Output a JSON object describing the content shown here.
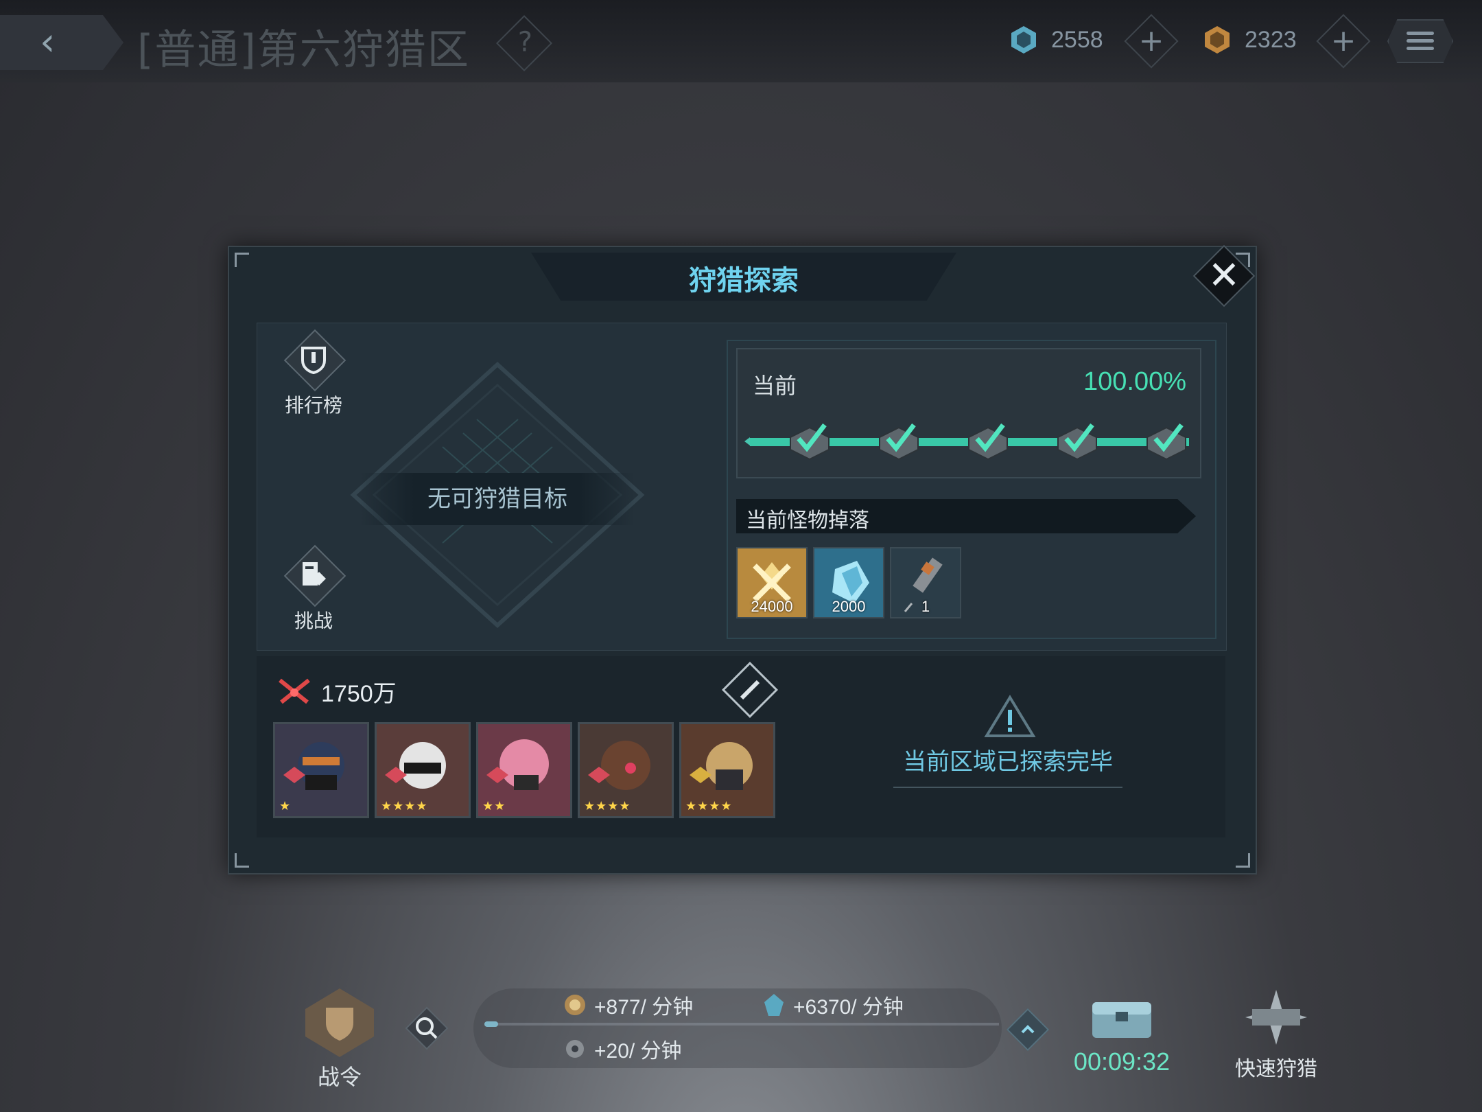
{
  "header": {
    "back_icon": "back-arrow-icon",
    "zone_title": "[普通]第六狩猎区",
    "help_label": "?",
    "resource1": {
      "icon": "blue-crystal-icon",
      "value": "2558"
    },
    "resource2": {
      "icon": "gold-crystal-icon",
      "value": "2323"
    },
    "plus_label": "+",
    "menu_icon": "menu-icon"
  },
  "panel": {
    "title": "狩猎探索",
    "close_label": "✕",
    "ranking_label": "排行榜",
    "challenge_label": "挑战",
    "target_label": "无可狩猎目标",
    "progress": {
      "label": "当前",
      "percent_text": "100.00%",
      "percent": 100,
      "checkpoints": [
        true,
        true,
        true,
        true,
        true
      ]
    },
    "drops_title": "当前怪物掉落",
    "drops": [
      {
        "icon": "gold-medal-icon",
        "count": "24000",
        "color": "#b88a3e"
      },
      {
        "icon": "blue-crystal-icon",
        "count": "2000",
        "color": "#2e6f8c"
      },
      {
        "icon": "syringe-icon",
        "count": "1",
        "color": "#2b3d48"
      }
    ],
    "team_power": "1750万",
    "heroes": [
      {
        "stars": "★",
        "color": "#3b3a4d"
      },
      {
        "stars": "★★★★",
        "color": "#5a3d3a"
      },
      {
        "stars": "★★",
        "color": "#6b3a48"
      },
      {
        "stars": "★★★★",
        "color": "#4a3a35"
      },
      {
        "stars": "★★★★",
        "color": "#5a3c2e"
      }
    ],
    "explored_text": "当前区域已探索完毕"
  },
  "bottom": {
    "pass_label": "战令",
    "income1": "+877/ 分钟",
    "income2": "+6370/ 分钟",
    "income3": "+20/ 分钟",
    "timer": "00:09:32",
    "quick_label": "快速狩猎"
  }
}
